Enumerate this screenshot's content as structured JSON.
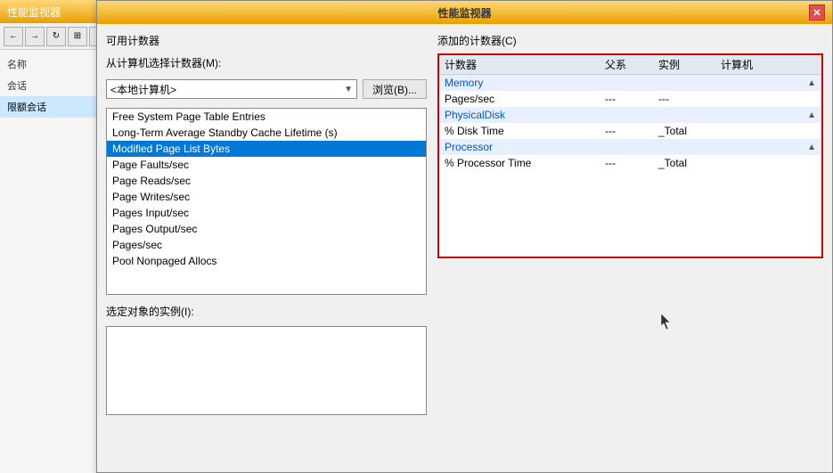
{
  "background": {
    "title": "性能监视器",
    "toolbar_buttons": [
      "←",
      "→",
      "↻"
    ],
    "sidebar_label": "名称",
    "sidebar_items": [
      "会话",
      "限额会话"
    ]
  },
  "dialog": {
    "title": "性能监视器",
    "left_panel": {
      "section_label": "可用计数器",
      "computer_select_label": "从计算机选择计数器(M):",
      "computer_value": "<本地计算机>",
      "browse_button": "浏览(B)...",
      "counter_list": [
        "Free System Page Table Entries",
        "Long-Term Average Standby Cache Lifetime (s)",
        "Modified Page List Bytes",
        "Page Faults/sec",
        "Page Reads/sec",
        "Page Writes/sec",
        "Pages Input/sec",
        "Pages Output/sec",
        "Pages/sec",
        "Pool Nonpaged Allocs"
      ],
      "selected_counter": "Modified Page List Bytes",
      "instance_label": "选定对象的实例(I):"
    },
    "right_panel": {
      "section_label": "添加的计数器(C)",
      "col_headers": {
        "counter": "计数器",
        "parent": "父系",
        "instance": "实例",
        "computer": "计算机"
      },
      "groups": [
        {
          "name": "Memory",
          "items": [
            {
              "counter": "Pages/sec",
              "parent": "---",
              "instance": "---",
              "computer": ""
            }
          ]
        },
        {
          "name": "PhysicalDisk",
          "items": [
            {
              "counter": "% Disk Time",
              "parent": "---",
              "instance": "_Total",
              "computer": ""
            }
          ]
        },
        {
          "name": "Processor",
          "items": [
            {
              "counter": "% Processor Time",
              "parent": "---",
              "instance": "_Total",
              "computer": ""
            }
          ]
        }
      ]
    }
  }
}
